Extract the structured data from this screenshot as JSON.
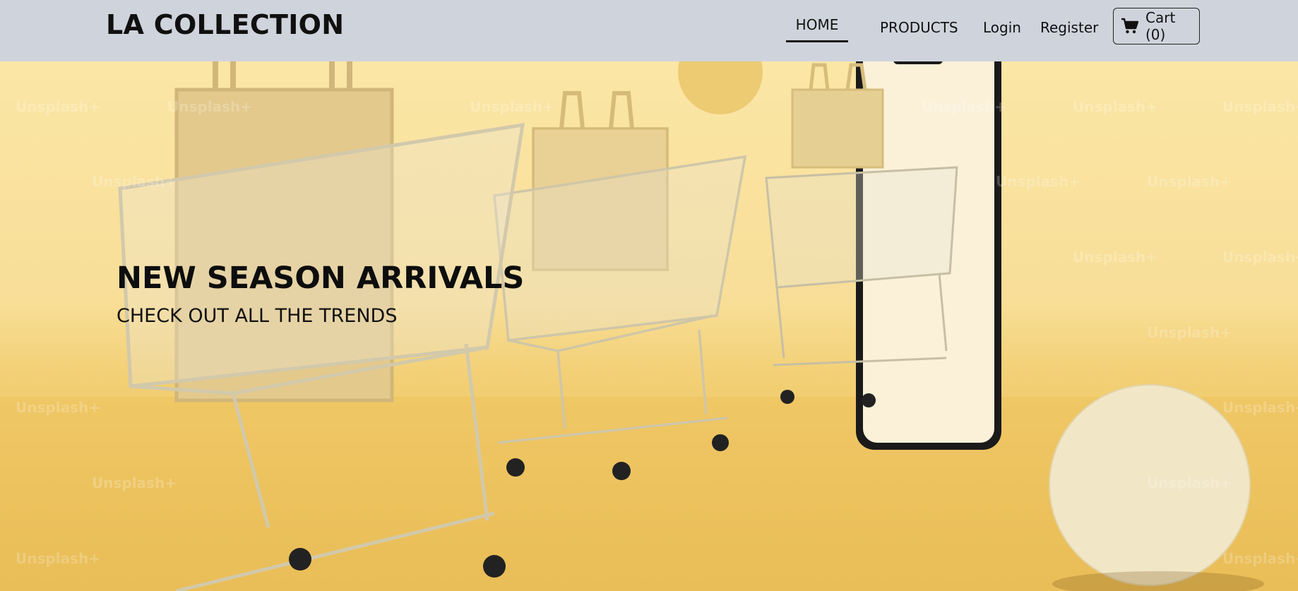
{
  "navbar": {
    "brand": "LA COLLECTION",
    "links": {
      "home": "HOME",
      "products": "PRODUCTS",
      "login": "Login",
      "register": "Register"
    },
    "cart_label": "Cart (0)",
    "cart_icon": "shopping-cart-icon"
  },
  "hero": {
    "title": "NEW SEASON ARRIVALS",
    "subtitle": "CHECK OUT ALL THE TRENDS",
    "watermark": "Unsplash+",
    "image_alt": "shopping-carts-with-bags-and-phone"
  },
  "colors": {
    "navbar_bg": "#cfd4dc",
    "hero_bg": "#f8de97",
    "text": "#111111"
  }
}
